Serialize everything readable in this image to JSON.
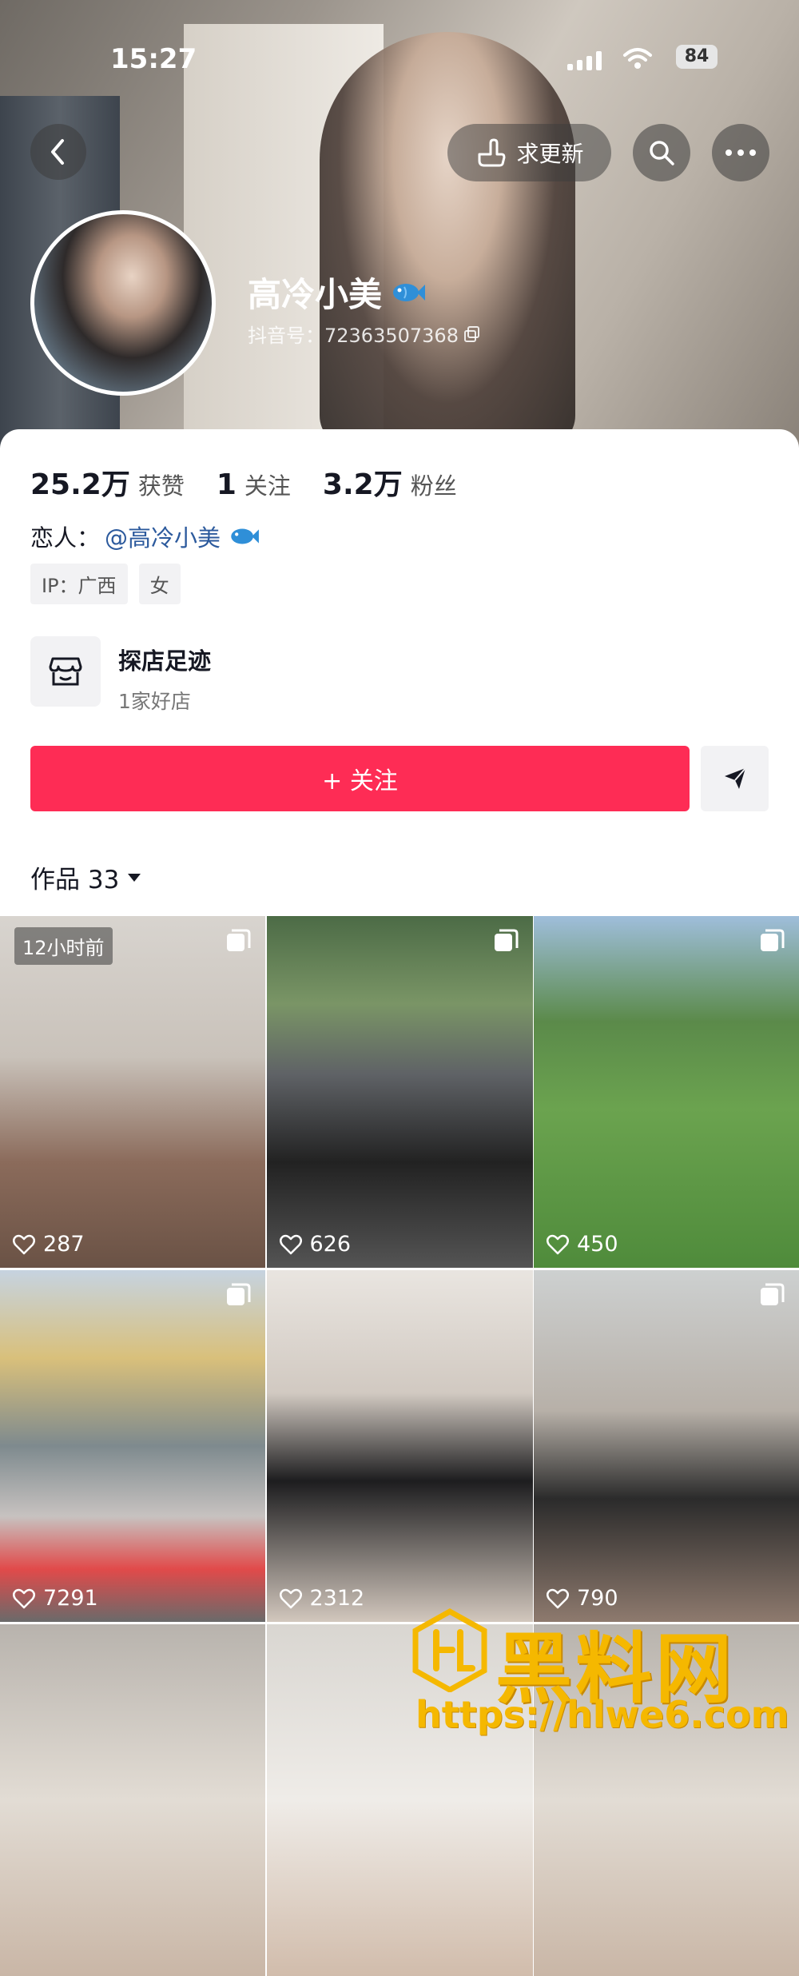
{
  "status_bar": {
    "time": "15:27",
    "battery": "84"
  },
  "header": {
    "request_update_label": "求更新"
  },
  "profile": {
    "name": "高冷小美",
    "douyin_id": "抖音号：72363507368",
    "stats": [
      {
        "value": "25.2万",
        "label": "获赞"
      },
      {
        "value": "1",
        "label": "关注"
      },
      {
        "value": "3.2万",
        "label": "粉丝"
      }
    ],
    "lover_label": "恋人：",
    "lover_name": "@高冷小美",
    "tags": [
      "IP：广西",
      "女"
    ],
    "shop": {
      "title": "探店足迹",
      "subtitle": "1家好店"
    },
    "follow_label": "+ 关注"
  },
  "works": {
    "label": "作品 33",
    "items": [
      {
        "likes": "287",
        "badge": "12小时前"
      },
      {
        "likes": "626"
      },
      {
        "likes": "450"
      },
      {
        "likes": "7291"
      },
      {
        "likes": "2312"
      },
      {
        "likes": "790"
      },
      {
        "likes": ""
      },
      {
        "likes": ""
      }
    ]
  },
  "watermark": {
    "text": "黑料网",
    "url": "https://hlwe6.com"
  },
  "colors": {
    "follow": "#fe2c55",
    "link": "#2c5a9d",
    "watermark": "#f5b800"
  }
}
